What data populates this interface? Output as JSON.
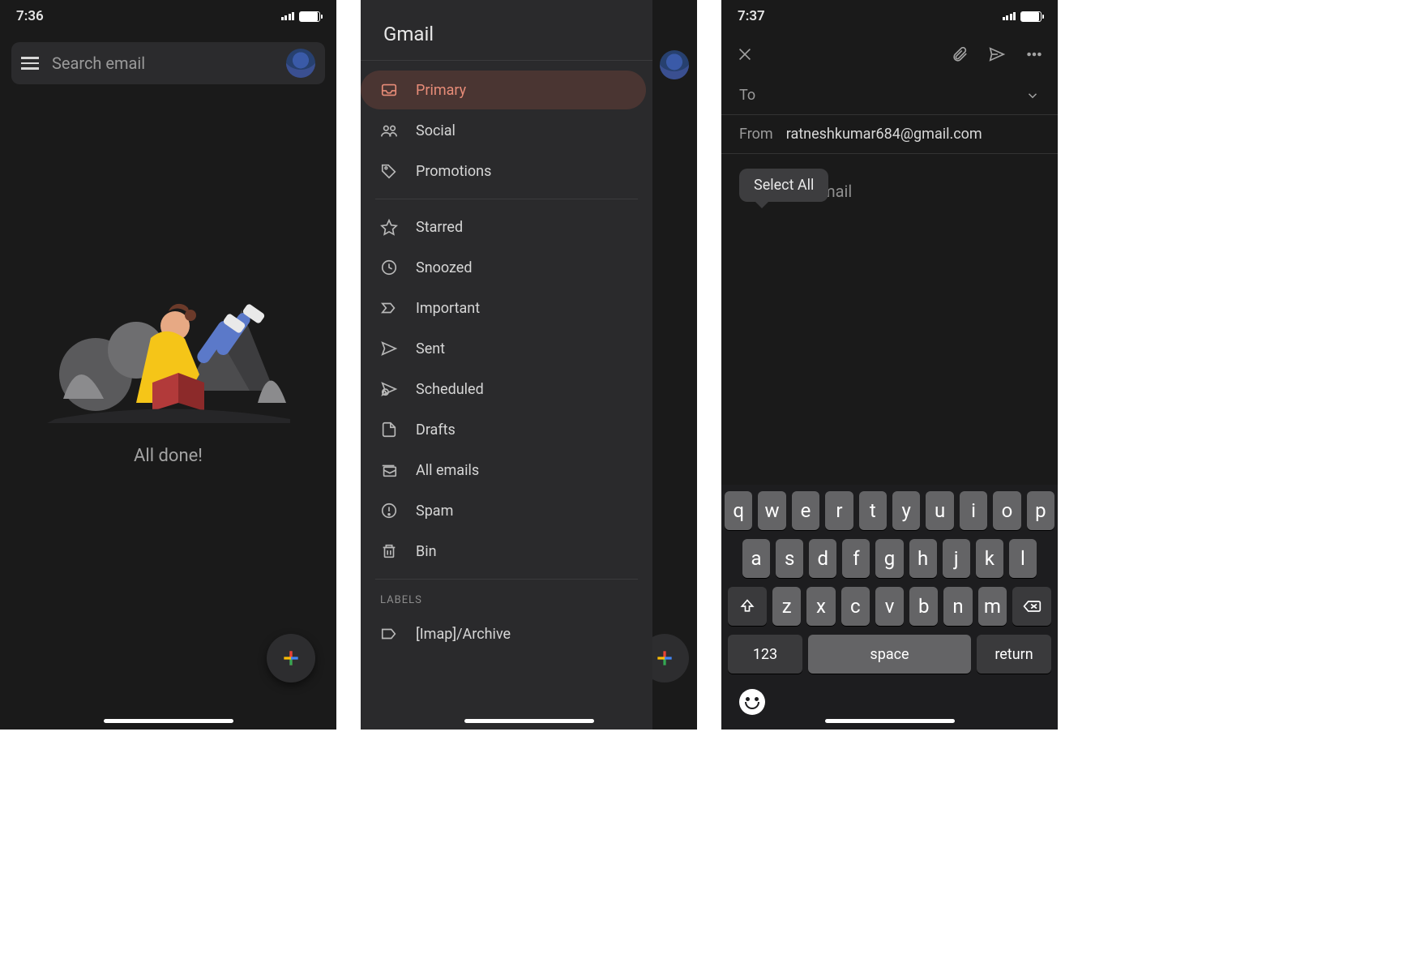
{
  "s1": {
    "time": "7:36",
    "search_placeholder": "Search email",
    "all_done": "All done!"
  },
  "s2": {
    "title": "Gmail",
    "categories": [
      {
        "label": "Primary",
        "icon": "inbox",
        "selected": true
      },
      {
        "label": "Social",
        "icon": "people",
        "selected": false
      },
      {
        "label": "Promotions",
        "icon": "tag",
        "selected": false
      }
    ],
    "folders": [
      {
        "label": "Starred",
        "icon": "star"
      },
      {
        "label": "Snoozed",
        "icon": "clock"
      },
      {
        "label": "Important",
        "icon": "important"
      },
      {
        "label": "Sent",
        "icon": "send"
      },
      {
        "label": "Scheduled",
        "icon": "scheduled"
      },
      {
        "label": "Drafts",
        "icon": "file"
      },
      {
        "label": "All emails",
        "icon": "stacked"
      },
      {
        "label": "Spam",
        "icon": "alert"
      },
      {
        "label": "Bin",
        "icon": "trash"
      }
    ],
    "labels_header": "LABELS",
    "labels": [
      {
        "label": "[Imap]/Archive",
        "icon": "label"
      }
    ]
  },
  "s3": {
    "time": "7:37",
    "to_label": "To",
    "from_label": "From",
    "from_value": "ratneshkumar684@gmail.com",
    "select_all": "Select All",
    "compose_placeholder": "Compose email",
    "keyboard": {
      "row1": [
        "q",
        "w",
        "e",
        "r",
        "t",
        "y",
        "u",
        "i",
        "o",
        "p"
      ],
      "row2": [
        "a",
        "s",
        "d",
        "f",
        "g",
        "h",
        "j",
        "k",
        "l"
      ],
      "row3": [
        "z",
        "x",
        "c",
        "v",
        "b",
        "n",
        "m"
      ],
      "numkey": "123",
      "space": "space",
      "return": "return"
    }
  }
}
